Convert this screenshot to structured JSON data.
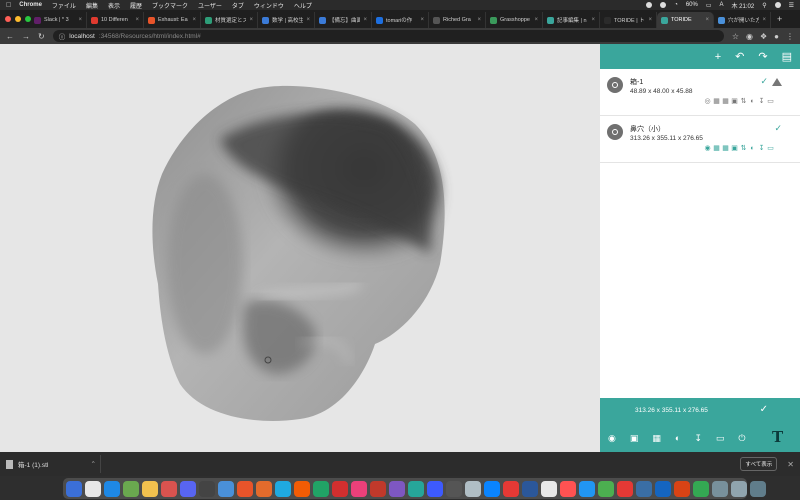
{
  "menubar": {
    "app": "Chrome",
    "items": [
      "ファイル",
      "編集",
      "表示",
      "履歴",
      "ブックマーク",
      "ユーザー",
      "タブ",
      "ウィンドウ",
      "ヘルプ"
    ],
    "battery": "60%",
    "clock": "木 21:02"
  },
  "tabs": [
    {
      "title": "Slack | * 3",
      "color": "#611f69"
    },
    {
      "title": "10 Differen",
      "color": "#e03a2f"
    },
    {
      "title": "Exhaust: Ea",
      "color": "#e8542a"
    },
    {
      "title": "材質選定とス",
      "color": "#2d9d78"
    },
    {
      "title": "数学 | 高校生",
      "color": "#3b7bd8"
    },
    {
      "title": "【備忘】曲面",
      "color": "#3b7bd8"
    },
    {
      "title": "tomariの作",
      "color": "#1d6fe0"
    },
    {
      "title": "Riched Gra",
      "color": "#555555"
    },
    {
      "title": "Grasshoppe",
      "color": "#3a9a5b"
    },
    {
      "title": "記事編集 | n",
      "color": "#3aa69c"
    },
    {
      "title": "TORIDE | トリ",
      "color": "#2b2b2b"
    },
    {
      "title": "TORIDE",
      "color": "#3aa69c"
    },
    {
      "title": "穴が開いた方",
      "color": "#4a90d9"
    }
  ],
  "address": {
    "host": "localhost",
    "path": ":34568/Resources/html/index.html#"
  },
  "panel": {
    "items": [
      {
        "name": "箱-1",
        "dims": "48.89 x 48.00 x 45.88",
        "has_warning": true
      },
      {
        "name": "鼻穴（小）",
        "dims": "313.26 x 355.11 x 276.65",
        "has_warning": false
      }
    ],
    "summary": "313.26 x 355.11 x 276.65",
    "logo_text": "T"
  },
  "downloads": {
    "file": "箱-1 (1).stl",
    "show_all": "すべて表示"
  },
  "colors": {
    "accent": "#3aa69c",
    "viewport_bg": "#e6e6e6"
  }
}
